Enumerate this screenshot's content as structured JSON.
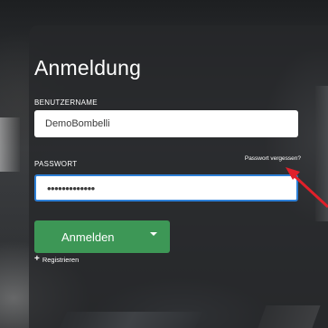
{
  "login": {
    "title": "Anmeldung",
    "username_label": "BENUTZERNAME",
    "username_value": "DemoBombelli",
    "password_label": "PASSWORT",
    "password_value": "•••••••••••••",
    "forgot_label": "Passwort vergessen?",
    "submit_label": "Anmelden",
    "register_label": "Registrieren"
  },
  "icons": {
    "dropdown": "chevron-down-icon",
    "register": "plus-icon",
    "cursor": "mouse-cursor-icon"
  },
  "colors": {
    "accent_green": "#3d9756",
    "focus_border": "#2d7fd6",
    "cursor_arrow": "#e0202a"
  }
}
